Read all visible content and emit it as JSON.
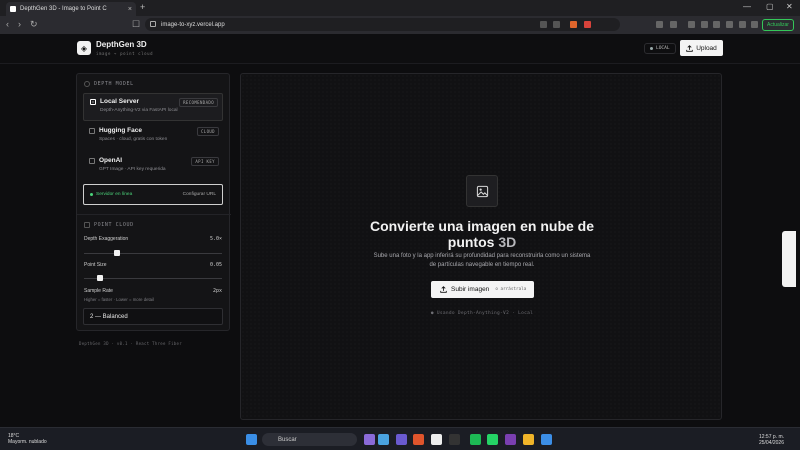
{
  "browser": {
    "tab_title": "DepthGen 3D - Image to Point C",
    "tab_close": "×",
    "new_tab": "+",
    "url": "image-to-xyz.vercel.app",
    "update_label": "Actualizar",
    "window_controls": [
      "—",
      "▢",
      "✕"
    ]
  },
  "header": {
    "brand": "DepthGen 3D",
    "tagline": "image → point cloud",
    "local_label": "LOCAL",
    "upload_label": "Upload"
  },
  "sidebar": {
    "depth_model_title": "DEPTH MODEL",
    "options": [
      {
        "title": "Local Server",
        "sub": "Depth-Anything-V2 via FastAPI local",
        "tag": "RECOMENDADO",
        "selected": true
      },
      {
        "title": "Hugging Face",
        "sub": "Spaces · cloud, gratis con token",
        "tag": "CLOUD",
        "selected": false
      },
      {
        "title": "OpenAI",
        "sub": "GPT Image · API key requerida",
        "tag": "API KEY",
        "selected": false
      }
    ],
    "server_status": "Servidor en línea",
    "configure_url": "Configurar URL",
    "point_cloud_title": "POINT CLOUD",
    "depth_exaggeration": {
      "label": "Depth Exaggeration",
      "value": "5.0×",
      "fraction": 0.23
    },
    "point_size": {
      "label": "Point Size",
      "value": "0.05",
      "fraction": 0.1
    },
    "sample_rate": {
      "label": "Sample Rate",
      "value": "2px",
      "hint": "Higher = faster · Lower = more detail",
      "selected": "2 — Balanced"
    }
  },
  "footer_note": "DepthGen 3D · v0.1 · React Three Fiber",
  "main": {
    "headline_line1": "Convierte una imagen en nube de",
    "headline_line2a": "puntos",
    "headline_line2b": "3D",
    "description": "Sube una foto y la app inferirá su profundidad para reconstruirla como un sistema de partículas navegable en tiempo real.",
    "cta_label": "Subir imagen",
    "cta_hint": "o arrástrala",
    "using_note": "Usando Depth-Anything-V2 · Local"
  },
  "taskbar": {
    "temperature": "18°C",
    "weather": "Mayorm. nublado",
    "search_label": "Buscar",
    "time": "12:57 p. m.",
    "date": "25/04/2026"
  },
  "colors": {
    "accent_green": "#4bd37a",
    "button_bg": "#f4f4f4",
    "update_green": "#34c759"
  }
}
